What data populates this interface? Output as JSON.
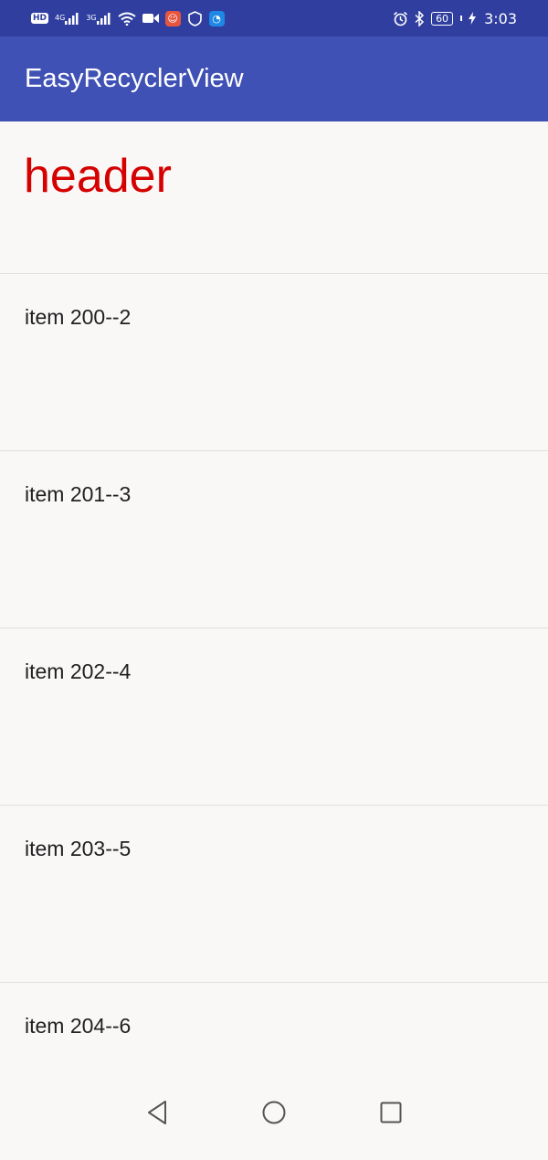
{
  "status_bar": {
    "network_hd": "HD",
    "signal_1_label": "4G",
    "signal_2_label": "3G",
    "battery_level": "60",
    "time": "3:03",
    "icons": [
      "hd-icon",
      "signal-4g-icon",
      "signal-3g-icon",
      "wifi-icon",
      "video-icon",
      "app-icon-red",
      "shield-icon",
      "app-icon-blue",
      "alarm-icon",
      "bluetooth-icon",
      "battery-icon",
      "charging-icon"
    ]
  },
  "toolbar": {
    "title": "EasyRecyclerView",
    "color": "#3f51b5"
  },
  "list": {
    "header": {
      "text": "header",
      "color": "#d50000"
    },
    "items": [
      {
        "label": "item 200--2"
      },
      {
        "label": "item 201--3"
      },
      {
        "label": "item 202--4"
      },
      {
        "label": "item 203--5"
      },
      {
        "label": "item 204--6"
      }
    ]
  },
  "nav_bar": {
    "icons": [
      "back-icon",
      "home-icon",
      "recents-icon"
    ]
  }
}
